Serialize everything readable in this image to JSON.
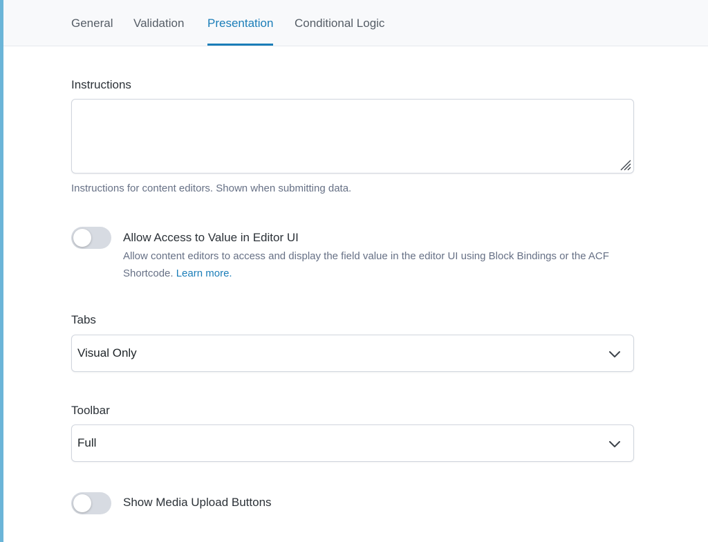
{
  "tabs": [
    {
      "label": "General",
      "active": false
    },
    {
      "label": "Validation",
      "active": false
    },
    {
      "label": "Presentation",
      "active": true
    },
    {
      "label": "Conditional Logic",
      "active": false
    }
  ],
  "instructions": {
    "label": "Instructions",
    "value": "",
    "help": "Instructions for content editors. Shown when submitting data."
  },
  "allow_access": {
    "label": "Allow Access to Value in Editor UI",
    "checked": false,
    "description": "Allow content editors to access and display the field value in the editor UI using Block Bindings or the ACF Shortcode.",
    "link_text": "Learn more."
  },
  "tabs_setting": {
    "label": "Tabs",
    "selected": "Visual Only"
  },
  "toolbar_setting": {
    "label": "Toolbar",
    "selected": "Full"
  },
  "media_upload": {
    "label": "Show Media Upload Buttons",
    "checked": false
  },
  "colors": {
    "accent": "#1a7db8",
    "left_bar": "#6bb5d8",
    "toggle_off": "#d7dbe2"
  }
}
